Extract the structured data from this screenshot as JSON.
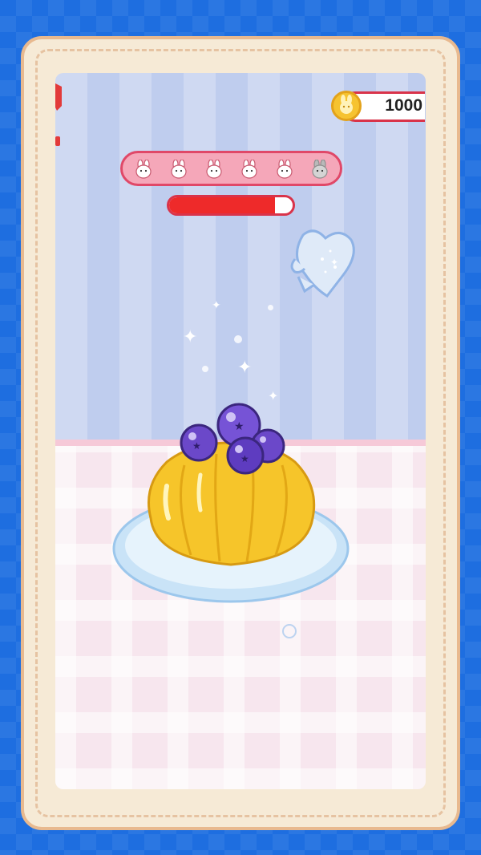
{
  "currency": {
    "amount": "1000",
    "icon": "bunny-coin-icon",
    "accent": "#d9334a"
  },
  "bunnies": {
    "count": 6,
    "earned": [
      true,
      true,
      true,
      true,
      true,
      false
    ],
    "earned_color": "#ffffff",
    "pending_color": "#b9b9b9"
  },
  "progress": {
    "fraction": 0.86,
    "fill_color": "#ee2a2a"
  },
  "tool": {
    "name": "heart-glove-icon"
  },
  "dessert": {
    "name": "blueberry-jelly-pudding-icon"
  }
}
